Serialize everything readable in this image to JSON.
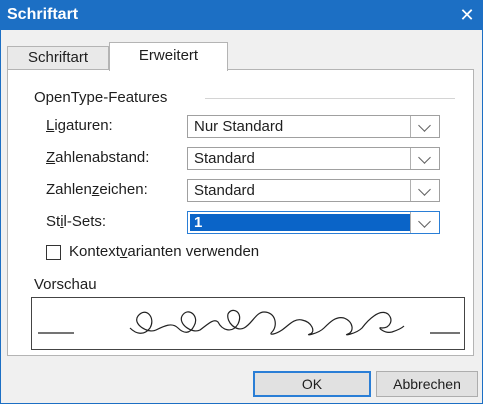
{
  "dialog": {
    "title": "Schriftart",
    "close_glyph": "✕"
  },
  "tabs": [
    {
      "label": "Schriftart",
      "active": false
    },
    {
      "label": "Erweitert",
      "active": true
    }
  ],
  "opentype": {
    "group_title": "OpenType-Features",
    "rows": [
      {
        "label_pre": "",
        "label_ul": "L",
        "label_post": "igaturen:",
        "value": "Nur Standard",
        "selected": false
      },
      {
        "label_pre": "",
        "label_ul": "Z",
        "label_post": "ahlenabstand:",
        "value": "Standard",
        "selected": false
      },
      {
        "label_pre": "Zahlen",
        "label_ul": "z",
        "label_post": "eichen:",
        "value": "Standard",
        "selected": false
      },
      {
        "label_pre": "St",
        "label_ul": "i",
        "label_post": "l-Sets:",
        "value": "1",
        "selected": true
      }
    ]
  },
  "contextual": {
    "label_pre": "Kontext",
    "label_ul": "v",
    "label_post": "arianten verwenden",
    "checked": false
  },
  "preview": {
    "label": "Vorschau"
  },
  "buttons": {
    "ok": "OK",
    "cancel": "Abbrechen"
  },
  "colors": {
    "titlebar": "#1c6fc4",
    "selection": "#0a64c8"
  },
  "icons": {
    "dropdown": "chevron-down-icon",
    "close": "close-icon"
  }
}
